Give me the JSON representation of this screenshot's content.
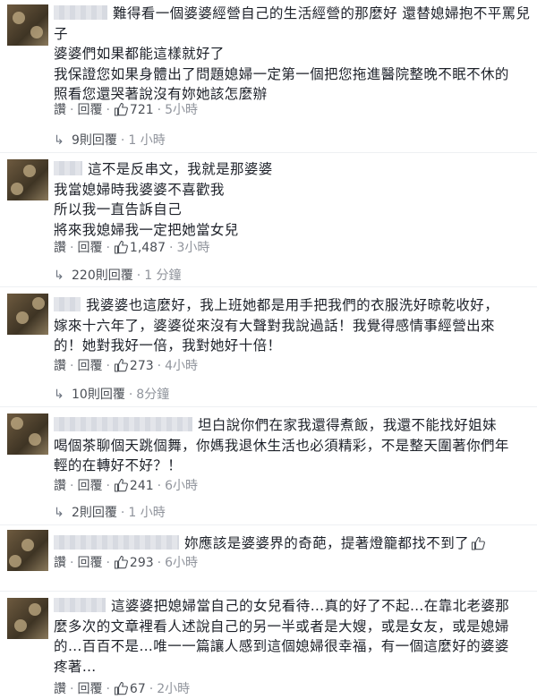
{
  "actions": {
    "like_label": "讚",
    "reply_label": "回覆",
    "dot": "·"
  },
  "comments": [
    {
      "first_line": "難得看一個婆婆經營自己的生活經營的那麼好 還替媳婦抱不平罵兒",
      "lines": [
        "子",
        "婆婆們如果都能這樣就好了",
        "我保證您如果身體出了問題媳婦一定第一個把您拖進醫院整晚不眠不休的",
        "照看您還哭著說沒有妳她該怎麼辦"
      ],
      "likes": "721",
      "time": "5小時",
      "replies_label": "9則回覆",
      "replies_time": "1 小時"
    },
    {
      "first_line": "這不是反串文，我就是那婆婆",
      "lines": [
        "我當媳婦時我婆婆不喜歡我",
        "所以我一直告訴自己",
        "將來我媳婦我一定把她當女兒"
      ],
      "likes": "1,487",
      "time": "3小時",
      "replies_label": "220則回覆",
      "replies_time": "1 分鐘"
    },
    {
      "first_line": "我婆婆也這麼好，我上班她都是用手把我們的衣服洗好晾乾收好，",
      "lines": [
        "嫁來十六年了，婆婆從來沒有大聲對我說過話！我覺得感情事經營出來",
        "的！她對我好一倍，我對她好十倍！"
      ],
      "likes": "273",
      "time": "4小時",
      "replies_label": "10則回覆",
      "replies_time": "8分鐘"
    },
    {
      "first_line": "坦白說你們在家我還得煮飯，我還不能找好姐妹",
      "lines": [
        "喝個茶聊個天跳個舞，你媽我退休生活也必須精彩，不是整天圍著你們年",
        "輕的在轉好不好？！"
      ],
      "likes": "241",
      "time": "6小時",
      "replies_label": "2則回覆",
      "replies_time": "1 小時"
    },
    {
      "first_line": "妳應該是婆婆界的奇葩，提著燈籠都找不到了",
      "lines": [],
      "likes": "293",
      "time": "6小時"
    },
    {
      "first_line": "這婆婆把媳婦當自己的女兒看待…真的好了不起…在靠北老婆那",
      "lines": [
        "麼多次的文章裡看人述說自己的另一半或者是大嫂，或是女友，或是媳婦",
        "的…百百不是…唯一一篇讓人感到這個媳婦很幸福，有一個這麼好的婆婆",
        "疼著…"
      ],
      "likes": "67",
      "time": "2小時"
    }
  ]
}
